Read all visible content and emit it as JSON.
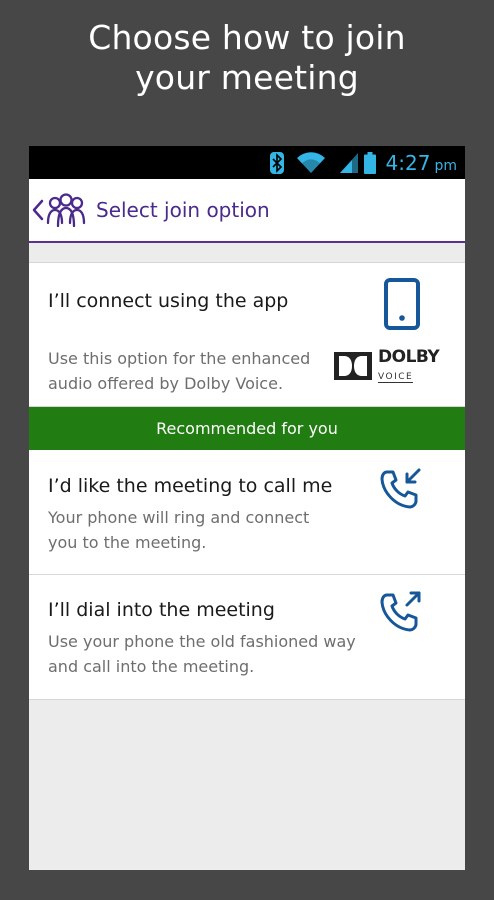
{
  "promo": {
    "line1": "Choose how to join",
    "line2": "your meeting"
  },
  "statusbar": {
    "time": "4:27",
    "ampm": "pm",
    "icons": [
      "bluetooth-icon",
      "wifi-icon",
      "signal-icon",
      "battery-icon"
    ],
    "accent": "#33b5e5"
  },
  "appbar": {
    "title": "Select join option",
    "logo_icon": "people-group-icon",
    "back_icon": "chevron-left-icon",
    "accent": "#4a2a8a"
  },
  "options": {
    "app": {
      "title": "I’ll connect using the app",
      "desc_line1": "Use this option for the enhanced",
      "desc_line2": "audio offered by Dolby Voice.",
      "icon": "mobile-phone-icon",
      "brand_word": "DOLBY",
      "brand_sub": "VOICE",
      "badge": "Recommended for you",
      "badge_color": "#217c12"
    },
    "call_me": {
      "title": "I’d like the meeting to call me",
      "desc_line1": "Your phone will ring and connect",
      "desc_line2": "you to the meeting.",
      "icon": "incoming-call-icon"
    },
    "dial_in": {
      "title": "I’ll dial into the meeting",
      "desc_line1": "Use your phone the old fashioned way",
      "desc_line2": "and call into the meeting.",
      "icon": "outgoing-call-icon"
    }
  }
}
